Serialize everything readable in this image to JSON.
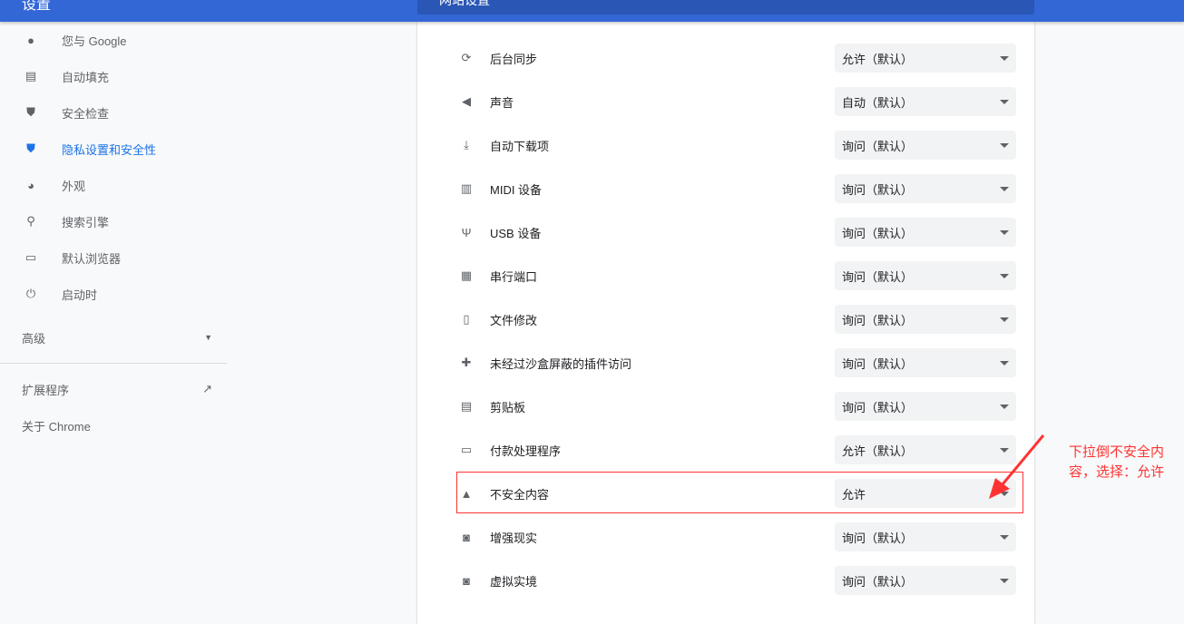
{
  "header": {
    "title": "设置",
    "subpage_title": "网站设置"
  },
  "sidebar": {
    "items": [
      {
        "label": "您与 Google",
        "icon": "person-icon"
      },
      {
        "label": "自动填充",
        "icon": "clipboard-icon"
      },
      {
        "label": "安全检查",
        "icon": "shield-check-icon"
      },
      {
        "label": "隐私设置和安全性",
        "icon": "shield-icon",
        "active": true
      },
      {
        "label": "外观",
        "icon": "palette-icon"
      },
      {
        "label": "搜索引擎",
        "icon": "search-icon"
      },
      {
        "label": "默认浏览器",
        "icon": "browser-icon"
      },
      {
        "label": "启动时",
        "icon": "power-icon"
      }
    ],
    "advanced": "高级",
    "extensions": "扩展程序",
    "about": "关于 Chrome"
  },
  "settings": [
    {
      "label": "后台同步",
      "value": "允许（默认）",
      "icon": "sync-icon"
    },
    {
      "label": "声音",
      "value": "自动（默认）",
      "icon": "volume-icon"
    },
    {
      "label": "自动下载项",
      "value": "询问（默认）",
      "icon": "download-icon"
    },
    {
      "label": "MIDI 设备",
      "value": "询问（默认）",
      "icon": "piano-icon"
    },
    {
      "label": "USB 设备",
      "value": "询问（默认）",
      "icon": "usb-icon"
    },
    {
      "label": "串行端口",
      "value": "询问（默认）",
      "icon": "serial-port-icon"
    },
    {
      "label": "文件修改",
      "value": "询问（默认）",
      "icon": "file-edit-icon"
    },
    {
      "label": "未经过沙盒屏蔽的插件访问",
      "value": "询问（默认）",
      "icon": "puzzle-icon"
    },
    {
      "label": "剪贴板",
      "value": "询问（默认）",
      "icon": "clipboard-icon"
    },
    {
      "label": "付款处理程序",
      "value": "允许（默认）",
      "icon": "credit-card-icon"
    },
    {
      "label": "不安全内容",
      "value": "允许",
      "icon": "warning-icon"
    },
    {
      "label": "增强现实",
      "value": "询问（默认）",
      "icon": "vr-icon"
    },
    {
      "label": "虚拟实境",
      "value": "询问（默认）",
      "icon": "vr-icon"
    }
  ],
  "annotation": {
    "text": "下拉倒不安全内容，选择：允许",
    "color": "#ff3333"
  }
}
